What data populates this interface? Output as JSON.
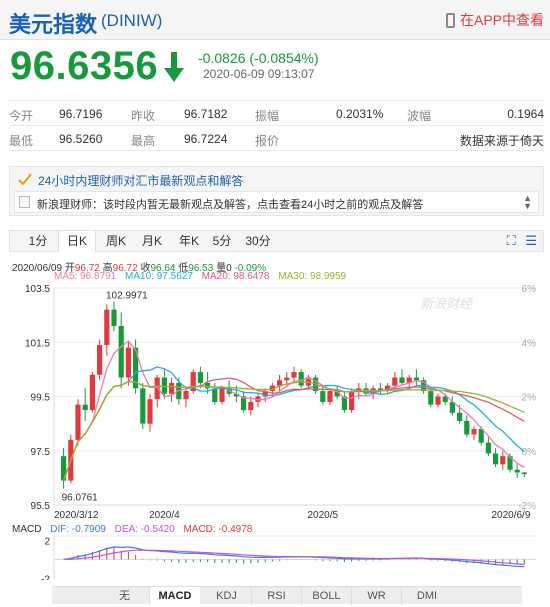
{
  "header": {
    "title": "美元指数",
    "code": "(DINIW)",
    "app_link": "在APP中查看"
  },
  "quote": {
    "price": "96.6356",
    "change": "-0.0826 (-0.0854%)",
    "timestamp": "2020-06-09 09:13:07"
  },
  "stats": {
    "row1": [
      [
        "今开",
        "96.7196"
      ],
      [
        "昨收",
        "96.7182"
      ],
      [
        "振幅",
        "0.2031%"
      ],
      [
        "波幅",
        "0.1964"
      ]
    ],
    "row2": [
      [
        "最低",
        "96.5260"
      ],
      [
        "最高",
        "96.7224"
      ],
      [
        "报价",
        "数据来源于倚天"
      ]
    ]
  },
  "news": {
    "heading": "24小时内理财师对汇市最新观点和解答",
    "item": "新浪理财师：该时段内暂无最新观点及解答，点击查看24小时之前的观点及解答"
  },
  "tabs": [
    "1分",
    "日K",
    "周K",
    "月K",
    "年K",
    "5分",
    "30分"
  ],
  "active_tab": "日K",
  "ohlc": {
    "date": "2020/06/09",
    "open_label": "开",
    "open": "96.72",
    "high_label": "高",
    "high": "96.72",
    "close_label": "收",
    "close": "96.64",
    "low_label": "低",
    "low": "96.53",
    "vol_label": "量",
    "vol": "0",
    "pct": "-0.09%"
  },
  "ma": {
    "ma5": "MA5: 96.8791",
    "ma10": "MA10: 97.5627",
    "ma20": "MA20: 98.6478",
    "ma30": "MA30: 98.9959"
  },
  "colors": {
    "up": "#e4393c",
    "down": "#189a3a",
    "ma5": "#f07ab0",
    "ma10": "#22aee0",
    "ma20": "#e05a7a",
    "ma30": "#9ab52a",
    "dif": "#3a7de0",
    "dea": "#c850e0"
  },
  "chart_data": {
    "type": "candlestick",
    "y_ticks": [
      "103.5",
      "101.5",
      "99.5",
      "97.5",
      "95.5"
    ],
    "y_pct_ticks": [
      "6%",
      "4%",
      "2%",
      "0%",
      "-2%"
    ],
    "ylim": [
      95.5,
      103.5
    ],
    "x_ticks": [
      "2020/3/12",
      "2020/4",
      "2020/5",
      "2020/6/9"
    ],
    "max_label": "102.9971",
    "min_label": "96.0761",
    "watermark": "新浪财经",
    "candles": [
      [
        97.3,
        97.6,
        96.1,
        96.4
      ],
      [
        96.4,
        98.1,
        96.3,
        97.9
      ],
      [
        97.9,
        99.4,
        97.7,
        99.2
      ],
      [
        99.2,
        99.8,
        98.6,
        99.0
      ],
      [
        99.0,
        100.4,
        98.9,
        100.3
      ],
      [
        100.3,
        101.6,
        100.1,
        101.4
      ],
      [
        101.4,
        102.9,
        101.0,
        102.7
      ],
      [
        102.7,
        103.0,
        101.9,
        102.1
      ],
      [
        102.1,
        102.6,
        99.8,
        100.2
      ],
      [
        100.2,
        101.5,
        99.9,
        101.3
      ],
      [
        101.3,
        101.6,
        99.6,
        99.8
      ],
      [
        99.8,
        100.0,
        98.3,
        98.5
      ],
      [
        98.5,
        99.6,
        98.2,
        99.4
      ],
      [
        99.4,
        100.3,
        99.1,
        100.2
      ],
      [
        100.2,
        100.5,
        99.4,
        99.6
      ],
      [
        99.6,
        100.2,
        99.3,
        100.0
      ],
      [
        100.0,
        100.2,
        99.2,
        99.4
      ],
      [
        99.4,
        99.8,
        99.1,
        99.7
      ],
      [
        99.7,
        100.5,
        99.6,
        100.4
      ],
      [
        100.4,
        100.6,
        99.8,
        100.0
      ],
      [
        100.0,
        100.4,
        99.6,
        99.8
      ],
      [
        99.8,
        100.0,
        99.2,
        99.3
      ],
      [
        99.3,
        99.9,
        99.2,
        99.8
      ],
      [
        99.8,
        100.1,
        99.5,
        99.6
      ],
      [
        99.6,
        99.9,
        99.3,
        99.5
      ],
      [
        99.5,
        99.7,
        98.9,
        99.0
      ],
      [
        99.0,
        99.5,
        98.8,
        99.3
      ],
      [
        99.3,
        99.6,
        99.1,
        99.5
      ],
      [
        99.5,
        99.8,
        99.3,
        99.7
      ],
      [
        99.7,
        100.0,
        99.5,
        99.9
      ],
      [
        99.9,
        100.3,
        99.7,
        100.1
      ],
      [
        100.1,
        100.4,
        99.9,
        100.2
      ],
      [
        100.2,
        100.6,
        100.0,
        100.4
      ],
      [
        100.4,
        100.5,
        99.8,
        99.9
      ],
      [
        99.9,
        100.3,
        99.8,
        100.2
      ],
      [
        100.2,
        100.3,
        99.6,
        99.7
      ],
      [
        99.7,
        99.9,
        99.2,
        99.3
      ],
      [
        99.3,
        99.8,
        99.2,
        99.7
      ],
      [
        99.7,
        99.9,
        99.4,
        99.5
      ],
      [
        99.5,
        99.7,
        98.9,
        99.0
      ],
      [
        99.0,
        99.8,
        98.9,
        99.7
      ],
      [
        99.7,
        100.0,
        99.4,
        99.8
      ],
      [
        99.8,
        100.0,
        99.5,
        99.6
      ],
      [
        99.6,
        99.9,
        99.4,
        99.8
      ],
      [
        99.8,
        100.0,
        99.6,
        99.7
      ],
      [
        99.7,
        100.0,
        99.6,
        99.9
      ],
      [
        99.9,
        100.4,
        99.8,
        100.2
      ],
      [
        100.2,
        100.5,
        99.9,
        100.0
      ],
      [
        100.0,
        100.3,
        99.8,
        100.2
      ],
      [
        100.2,
        100.5,
        99.9,
        100.1
      ],
      [
        100.1,
        100.2,
        99.6,
        99.7
      ],
      [
        99.7,
        99.8,
        99.1,
        99.2
      ],
      [
        99.2,
        99.6,
        99.1,
        99.5
      ],
      [
        99.5,
        99.6,
        99.2,
        99.3
      ],
      [
        99.3,
        99.5,
        98.8,
        98.9
      ],
      [
        98.9,
        99.2,
        98.5,
        98.6
      ],
      [
        98.6,
        98.8,
        98.0,
        98.1
      ],
      [
        98.1,
        98.4,
        97.9,
        98.3
      ],
      [
        98.3,
        98.4,
        97.7,
        97.8
      ],
      [
        97.8,
        98.0,
        97.3,
        97.4
      ],
      [
        97.4,
        97.6,
        96.9,
        97.0
      ],
      [
        97.0,
        97.5,
        96.8,
        97.3
      ],
      [
        97.3,
        97.4,
        96.7,
        96.8
      ],
      [
        96.8,
        97.0,
        96.5,
        96.7
      ],
      [
        96.7,
        96.72,
        96.53,
        96.64
      ]
    ]
  },
  "macd": {
    "legend": {
      "label": "MACD",
      "dif": "DIF: -0.7909",
      "dea": "DEA: -0.5420",
      "macd": "MACD: -0.4978"
    },
    "y_ticks": [
      "2",
      "-2"
    ],
    "ylim": [
      -2.5,
      2.5
    ]
  },
  "indicators": [
    "无",
    "MACD",
    "KDJ",
    "RSI",
    "BOLL",
    "WR",
    "DMI"
  ],
  "active_indicator": "MACD"
}
